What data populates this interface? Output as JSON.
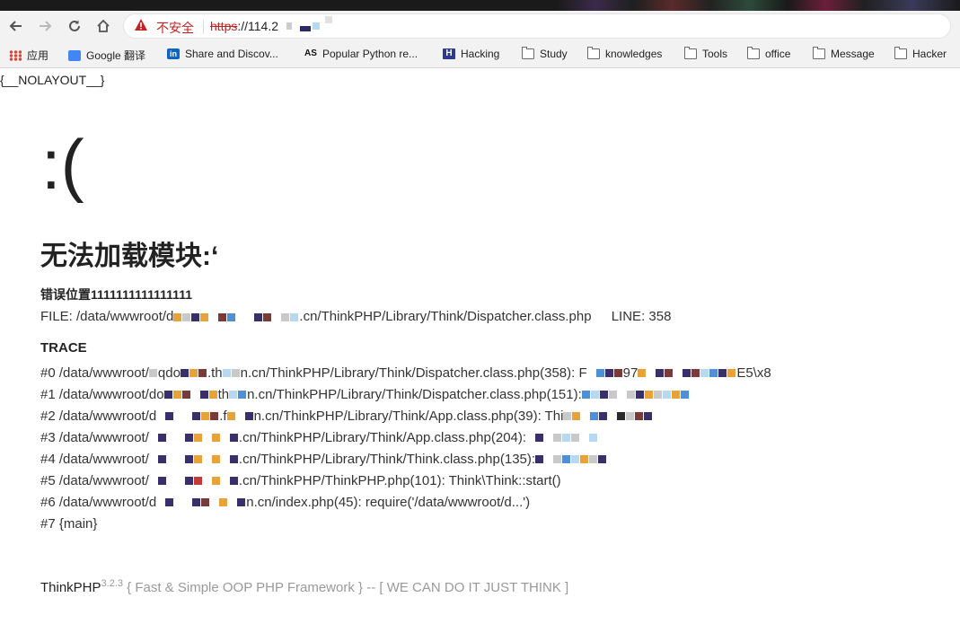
{
  "browser": {
    "security_label": "不安全",
    "url_scheme": "https",
    "url_rest": "://114.2",
    "bookmarks": [
      {
        "label": "应用",
        "icon": "apps-grid-icon"
      },
      {
        "label": "Google 翻译",
        "icon": "google-translate-icon"
      },
      {
        "label": "Share and Discov...",
        "icon": "linkedin-icon"
      },
      {
        "label": "Popular Python re...",
        "icon": "as-logo-icon"
      },
      {
        "label": "Hacking",
        "icon": "h-logo-icon"
      },
      {
        "label": "Study",
        "icon": "folder-icon"
      },
      {
        "label": "knowledges",
        "icon": "folder-icon"
      },
      {
        "label": "Tools",
        "icon": "folder-icon"
      },
      {
        "label": "office",
        "icon": "folder-icon"
      },
      {
        "label": "Message",
        "icon": "folder-icon"
      },
      {
        "label": "Hacker",
        "icon": "folder-icon"
      }
    ]
  },
  "page": {
    "nolayout": "{__NOLAYOUT__}",
    "face": ":(",
    "error_title": "无法加载模块:‘",
    "error_position": "错误位置1111111111111111",
    "file_prefix": "FILE: /data/wwwroot/d",
    "file_suffix": ".cn/ThinkPHP/Library/Think/Dispatcher.class.php",
    "line": "LINE: 358",
    "trace_label": "TRACE",
    "trace": [
      {
        "a": "#0 /data/wwwroot/",
        "b": "qdo",
        "c": ".th",
        "d": "n.cn/ThinkPHP/Library/Think/Dispatcher.class.php(358): F",
        "e": "97",
        "f": "E5\\x8"
      },
      {
        "a": "#1 /data/wwwroot/do",
        "b": "",
        "c": "th",
        "d": "n.cn/ThinkPHP/Library/Think/Dispatcher.class.php(151):",
        "e": "",
        "f": ""
      },
      {
        "a": "#2 /data/wwwroot/d",
        "b": "",
        "c": ".f",
        "d": "n.cn/ThinkPHP/Library/Think/App.class.php(39): Thi",
        "e": "",
        "f": ""
      },
      {
        "a": "#3 /data/wwwroot/",
        "b": "",
        "c": "",
        "d": ".cn/ThinkPHP/Library/Think/App.class.php(204):",
        "e": "",
        "f": ""
      },
      {
        "a": "#4 /data/wwwroot/",
        "b": "",
        "c": "",
        "d": ".cn/ThinkPHP/Library/Think/Think.class.php(135):",
        "e": "",
        "f": ""
      },
      {
        "a": "#5 /data/wwwroot/",
        "b": "",
        "c": "",
        "d": ".cn/ThinkPHP/ThinkPHP.php(101): Think\\Think::start()",
        "e": "",
        "f": ""
      },
      {
        "a": "#6 /data/wwwroot/d",
        "b": "",
        "c": "",
        "d": "n.cn/index.php(45): require('/data/wwwroot/d...')",
        "e": "",
        "f": ""
      },
      {
        "a": "#7 {main}",
        "b": "",
        "c": "",
        "d": "",
        "e": "",
        "f": ""
      }
    ],
    "footer_brand": "ThinkPHP",
    "footer_version": "3.2.3",
    "footer_slogan": " { Fast & Simple OOP PHP Framework } -- [ WE CAN DO IT JUST THINK ]"
  },
  "colors": {
    "insecure_red": "#c5221f",
    "mosaic": [
      "#e8a23a",
      "#3b2f6b",
      "#7a3a3a",
      "#4f8fd6",
      "#b7d9ef",
      "#c9c9c9",
      "#2a2a2a",
      "#c23b3b"
    ]
  }
}
